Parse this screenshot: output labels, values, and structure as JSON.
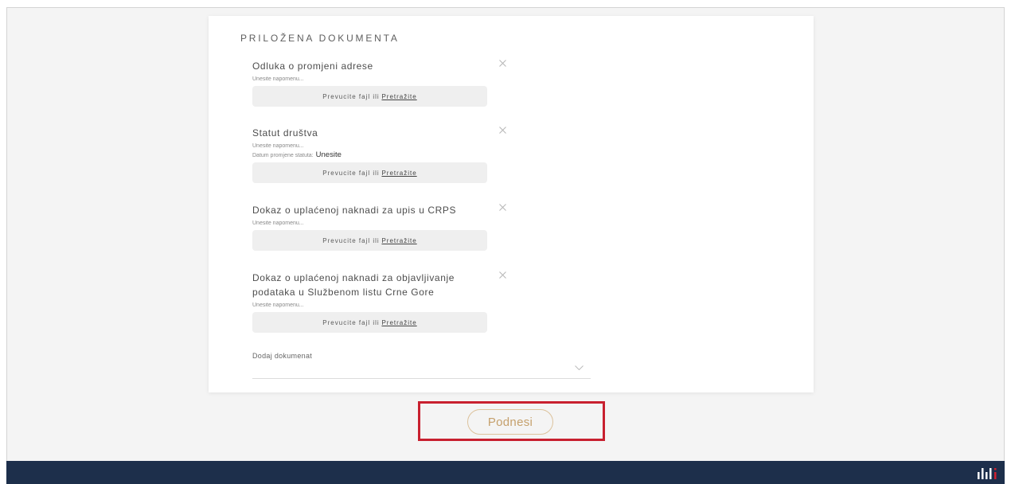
{
  "section": {
    "heading": "PRILOŽENA DOKUMENTA"
  },
  "documents": [
    {
      "title": "Odluka o promjeni adrese",
      "note_placeholder": "Unesite napomenu..."
    },
    {
      "title": "Statut društva",
      "note_placeholder": "Unesite napomenu...",
      "date_label": "Datum promjene statuta:",
      "date_value": "Unesite"
    },
    {
      "title": "Dokaz o uplaćenoj naknadi za upis u CRPS",
      "note_placeholder": "Unesite napomenu..."
    },
    {
      "title": "Dokaz o uplaćenoj naknadi za objavljivanje podataka u Službenom listu Crne Gore",
      "note_placeholder": "Unesite napomenu..."
    }
  ],
  "upload": {
    "text": "Prevucite fajl ili",
    "link": "Pretražite"
  },
  "add_document": {
    "label": "Dodaj dokumenat"
  },
  "submit": {
    "label": "Podnesi"
  },
  "icons": {
    "remove_document": "close-icon",
    "select_toggle": "chevron-down-icon",
    "footer_logo": "logo"
  },
  "colors": {
    "page_bg": "#f4f4f4",
    "accent": "#c5a06c",
    "accent_border": "#dcc29c",
    "highlight": "#c8202f",
    "footer_bg": "#1d2f4b",
    "logo_red": "#d0202f"
  }
}
